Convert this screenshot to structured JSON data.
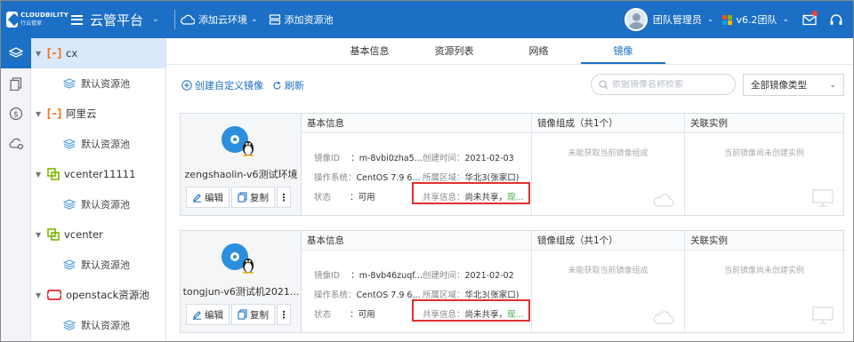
{
  "header": {
    "logo_text": "CLOUDBILITY",
    "logo_sub": "行云管家",
    "app_title": "云管平台",
    "add_env": "添加云环境",
    "add_pool": "添加资源池",
    "user_name": "团队管理员",
    "team_name": "v6.2团队"
  },
  "tree": {
    "nodes": [
      {
        "label": "cx",
        "child": "默认资源池",
        "icon": "cloud-bracket-icon"
      },
      {
        "label": "阿里云",
        "child": "默认资源池",
        "icon": "cloud-bracket-icon"
      },
      {
        "label": "vcenter11111",
        "child": "默认资源池",
        "icon": "vmware-icon"
      },
      {
        "label": "vcenter",
        "child": "默认资源池",
        "icon": "vmware-icon"
      },
      {
        "label": "openstack资源池",
        "child": "默认资源池",
        "icon": "openstack-icon"
      }
    ]
  },
  "tabs": [
    "基本信息",
    "资源列表",
    "网络",
    "镜像"
  ],
  "toolbar": {
    "create_image": "创建自定义镜像",
    "refresh": "刷新",
    "search_placeholder": "依据镜像名称检索",
    "type_select": "全部镜像类型"
  },
  "labels": {
    "basic_info": "基本信息",
    "composition": "镜像组成（共1个）",
    "related": "关联实例",
    "image_id": "镜像ID",
    "created": "创建时间：",
    "os": "操作系统：",
    "region": "所属区域：",
    "status": "状态",
    "share": "共享信息：",
    "edit": "编辑",
    "copy": "复制",
    "no_composition": "未能获取当前镜像组成",
    "no_instances": "当前镜像尚未创建实例"
  },
  "images": [
    {
      "name": "zengshaolin-v6测试环境",
      "id": "：m-8vbi0zha5...",
      "created": "2021-02-03",
      "os": "CentOS 7.9 6...",
      "region": "华北3(张家口)",
      "status": "：可用",
      "share_value": "尚未共享，",
      "share_link": "现..."
    },
    {
      "name": "tongjun-v6测试机2021...",
      "id": "：m-8vb46zuqf...",
      "created": "2021-02-02",
      "os": "CentOS 7.9 6...",
      "region": "华北3(张家口)",
      "status": "：可用",
      "share_value": "尚未共享，",
      "share_link": "现..."
    }
  ],
  "colors": {
    "primary": "#1b6fc4",
    "highlight_border": "#e03030",
    "link_green": "#3aa53a"
  }
}
